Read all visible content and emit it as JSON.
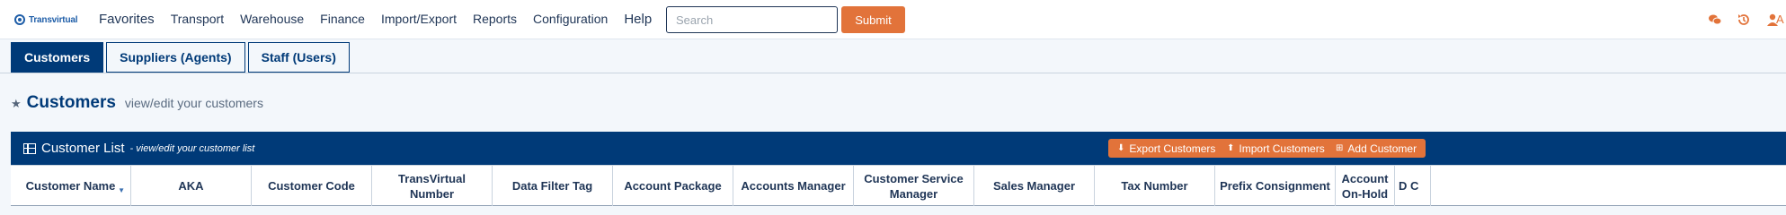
{
  "brand": {
    "logo_text": "Transvirtual"
  },
  "nav": {
    "items": [
      "Favorites",
      "Transport",
      "Warehouse",
      "Finance",
      "Import/Export",
      "Reports",
      "Configuration",
      "Help"
    ]
  },
  "search": {
    "placeholder": "Search",
    "value": ""
  },
  "submit_label": "Submit",
  "top_icons": [
    "chat-icon",
    "history-icon",
    "user-icon"
  ],
  "user_tail": "A",
  "tabs": [
    {
      "label": "Customers",
      "active": true
    },
    {
      "label": "Suppliers (Agents)",
      "active": false
    },
    {
      "label": "Staff (Users)",
      "active": false
    }
  ],
  "heading": {
    "title": "Customers",
    "subtitle": "view/edit your customers"
  },
  "panel": {
    "title": "Customer List",
    "subtitle": "- view/edit your customer list",
    "buttons": {
      "export": "Export Customers",
      "import": "Import Customers",
      "add": "Add Customer"
    }
  },
  "table": {
    "columns": [
      "Customer Name",
      "AKA",
      "Customer Code",
      "TransVirtual Number",
      "Data Filter Tag",
      "Account Package",
      "Accounts Manager",
      "Customer Service Manager",
      "Sales Manager",
      "Tax Number",
      "Prefix Consignment",
      "Account On-Hold",
      "D C"
    ]
  },
  "colors": {
    "primary": "#003a78",
    "accent": "#e2733a",
    "background": "#f3f7fb"
  }
}
